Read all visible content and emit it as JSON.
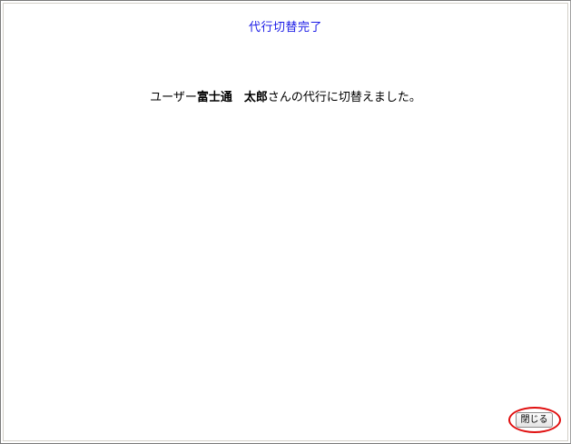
{
  "page": {
    "title": "代行切替完了"
  },
  "message": {
    "prefix": "ユーザー",
    "user_name": "富士通　太郎",
    "suffix": "さんの代行に切替えました。"
  },
  "actions": {
    "close_label": "閉じる"
  },
  "colors": {
    "title": "#1a1ae6",
    "highlight": "#e01010"
  }
}
